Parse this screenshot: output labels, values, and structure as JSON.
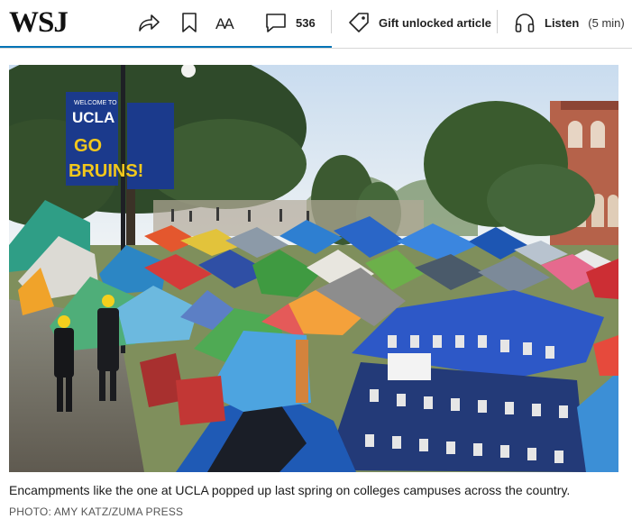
{
  "header": {
    "logo": "WSJ",
    "share_icon": "share-arrow-icon",
    "bookmark_icon": "bookmark-icon",
    "text_size_label": "AA",
    "comments_count": "536",
    "gift_label": "Gift unlocked article",
    "listen_label": "Listen",
    "listen_duration": "(5 min)",
    "accent_color": "#0274b6"
  },
  "photo": {
    "banner_welcome": "WELCOME TO",
    "banner_school": "UCLA",
    "banner_go": "GO",
    "banner_bruins": "BRUINS!",
    "caption": "Encampments like the one at UCLA popped up last spring on colleges campuses across the country.",
    "credit": "PHOTO: AMY KATZ/ZUMA PRESS"
  }
}
